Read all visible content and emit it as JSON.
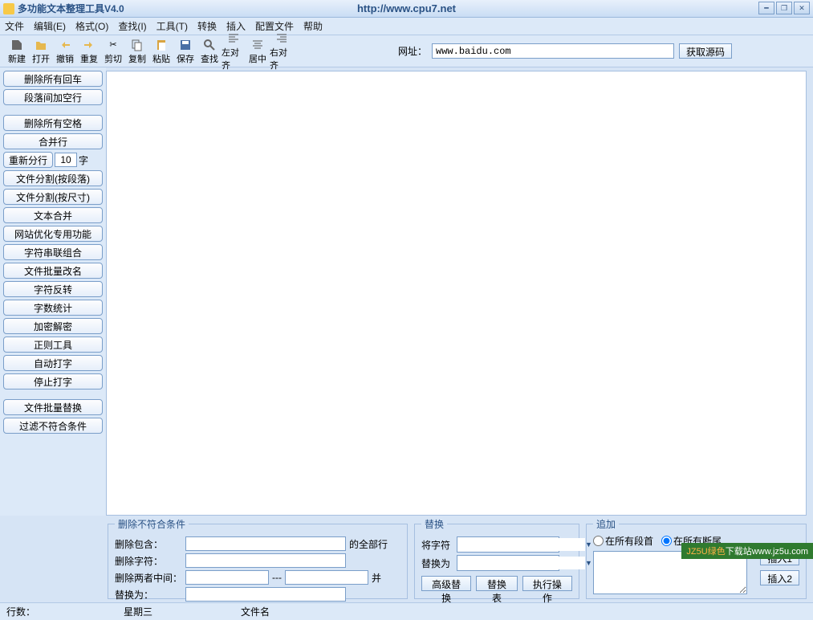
{
  "title": {
    "app": "多功能文本整理工具V4.0",
    "url": "http://www.cpu7.net"
  },
  "menu": {
    "file": "文件",
    "edit": "编辑(E)",
    "format": "格式(O)",
    "find": "查找(I)",
    "tools": "工具(T)",
    "convert": "转换",
    "insert": "插入",
    "config": "配置文件",
    "help": "帮助"
  },
  "toolbar": {
    "new": "新建",
    "open": "打开",
    "undo": "撤销",
    "redo": "重复",
    "cut": "剪切",
    "copy": "复制",
    "paste": "粘贴",
    "save": "保存",
    "find": "查找",
    "alignL": "左对齐",
    "alignC": "居中",
    "alignR": "右对齐",
    "urlLabel": "网址：",
    "urlValue": "www.baidu.com",
    "getSource": "获取源码"
  },
  "sidebar": {
    "delAllCR": "删除所有回车",
    "paraBlank": "段落间加空行",
    "delAllSpace": "删除所有空格",
    "mergeLine": "合并行",
    "resplit": "重新分行",
    "resplitNum": "10",
    "resplitUnit": "字",
    "fileSplitPara": "文件分割(按段落)",
    "fileSplitSize": "文件分割(按尺寸)",
    "textMerge": "文本合并",
    "seoFunc": "网站优化专用功能",
    "strSerial": "字符串联组合",
    "batchRename": "文件批量改名",
    "strReverse": "字符反转",
    "wordCount": "字数统计",
    "crypto": "加密解密",
    "regex": "正则工具",
    "autoType": "自动打字",
    "stopType": "停止打字",
    "batchReplace": "文件批量替换",
    "filterNoMatch": "过滤不符合条件"
  },
  "panels": {
    "delete": {
      "legend": "删除不符合条件",
      "contains": "删除包含：",
      "containsSuffix": "的全部行",
      "char": "删除字符：",
      "between": "删除两者中间：",
      "dash": "---",
      "betweenSuffix": "并",
      "replaceAs": "替换为："
    },
    "replace": {
      "legend": "替换",
      "from": "将字符",
      "to": "替换为",
      "adv": "高级替换",
      "table": "替换表",
      "exec": "执行操作"
    },
    "append": {
      "legend": "追加",
      "atHead": "在所有段首",
      "atTail": "在所有断尾",
      "insert1": "插入1",
      "insert2": "插入2"
    }
  },
  "status": {
    "rows": "行数：",
    "day": "星期三",
    "filename": "文件名"
  },
  "watermark": {
    "green": "JZ5U绿色",
    "white": "下载站www.jz5u.com"
  }
}
